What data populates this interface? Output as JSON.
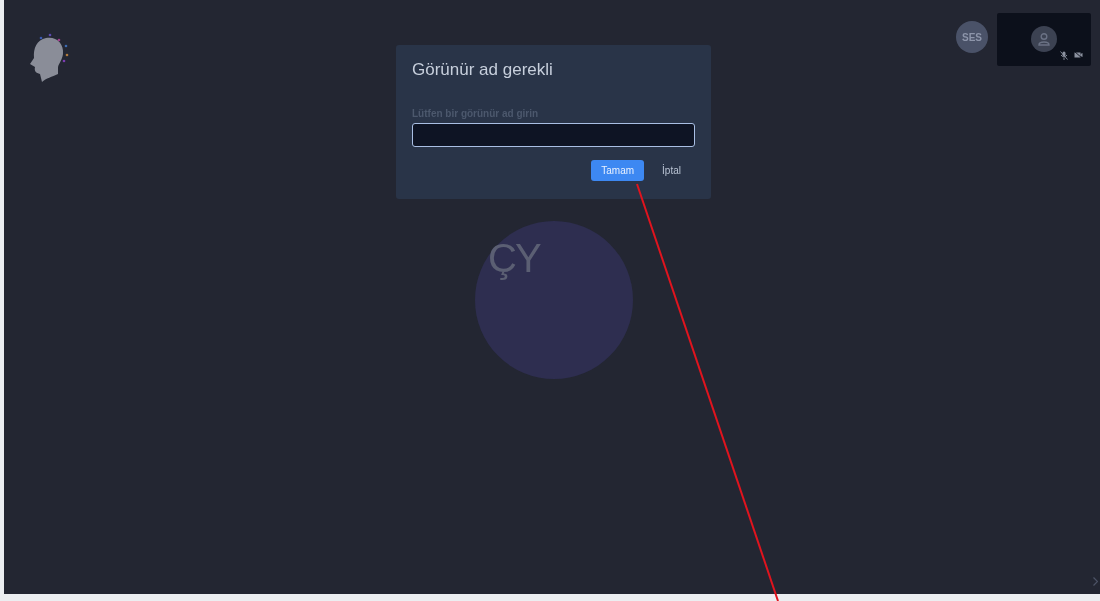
{
  "dialog": {
    "title": "Görünür ad gerekli",
    "field": {
      "label": "Lütfen bir görünür ad girin"
    },
    "buttons": [
      {
        "label": "Tamam",
        "kind": "primary"
      },
      {
        "label": "İptal",
        "kind": "secondary"
      }
    ]
  },
  "main_avatar": {
    "initials": "ÇY"
  },
  "participant": {
    "initials": "SES"
  },
  "self_view": {
    "muted": true,
    "camera_off": true
  }
}
